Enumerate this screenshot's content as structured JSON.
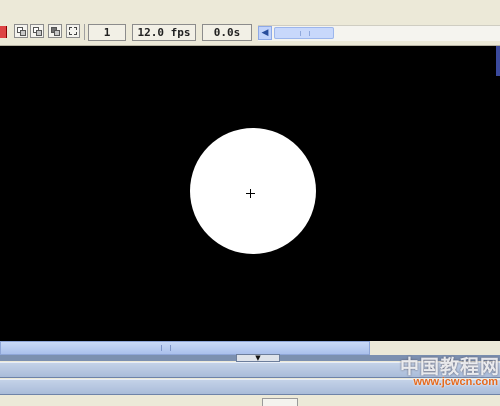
{
  "toolbar": {
    "frame_number": "1",
    "frame_rate": "12.0 fps",
    "elapsed_time": "0.0s",
    "buttons": [
      {
        "name": "center-frame-button",
        "icon": "center-frame-icon"
      },
      {
        "name": "onion-skin-button",
        "icon": "onion-skin-icon"
      },
      {
        "name": "onion-skin-outlines-button",
        "icon": "onion-skin-outlines-icon"
      },
      {
        "name": "edit-multiple-frames-button",
        "icon": "edit-multiple-frames-icon"
      }
    ],
    "scroll_left_arrow": "◀"
  },
  "stage": {
    "background": "#000000",
    "shape": "circle",
    "shape_color": "#ffffff",
    "registration_mark": "+"
  },
  "timeline": {
    "collapse_arrow": "▼"
  },
  "watermark": {
    "chinese": "中国教程网",
    "url": "www.jcwcn.com"
  }
}
